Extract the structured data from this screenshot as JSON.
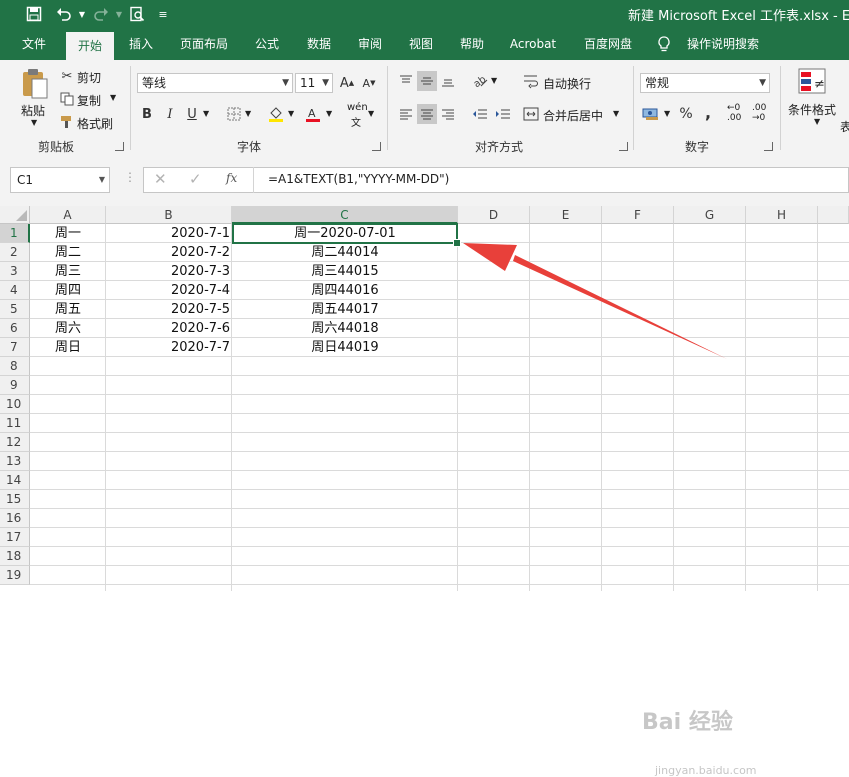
{
  "window": {
    "title": "新建 Microsoft Excel 工作表.xlsx - Exc"
  },
  "tabs": [
    "文件",
    "开始",
    "插入",
    "页面布局",
    "公式",
    "数据",
    "审阅",
    "视图",
    "帮助",
    "Acrobat",
    "百度网盘",
    "操作说明搜索"
  ],
  "ribbon": {
    "clipboard": {
      "paste": "粘贴",
      "cut": "剪切",
      "copy": "复制",
      "format_painter": "格式刷",
      "label": "剪贴板"
    },
    "font": {
      "name": "等线",
      "size": "11",
      "bold": "B",
      "italic": "I",
      "underline": "U",
      "phonetic": "wén",
      "label": "字体"
    },
    "alignment": {
      "wrap_text": "自动换行",
      "merge_center": "合并后居中",
      "label": "对齐方式"
    },
    "number": {
      "format": "常规",
      "percent": "%",
      "comma": ",",
      "label": "数字"
    },
    "styles": {
      "conditional": "条件格式",
      "cut_text": "表"
    }
  },
  "formula_bar": {
    "name_box": "C1",
    "fx": "fx",
    "formula": "=A1&TEXT(B1,\"YYYY-MM-DD\")"
  },
  "sheet": {
    "columns": [
      "A",
      "B",
      "C",
      "D",
      "E",
      "F",
      "G",
      "H"
    ],
    "rows": [
      "1",
      "2",
      "3",
      "4",
      "5",
      "6",
      "7",
      "8",
      "9",
      "10",
      "11",
      "12",
      "13",
      "14",
      "15",
      "16",
      "17",
      "18",
      "19"
    ],
    "data": [
      [
        "周一",
        "2020-7-1",
        "周一2020-07-01"
      ],
      [
        "周二",
        "2020-7-2",
        "周二44014"
      ],
      [
        "周三",
        "2020-7-3",
        "周三44015"
      ],
      [
        "周四",
        "2020-7-4",
        "周四44016"
      ],
      [
        "周五",
        "2020-7-5",
        "周五44017"
      ],
      [
        "周六",
        "2020-7-6",
        "周六44018"
      ],
      [
        "周日",
        "2020-7-7",
        "周日44019"
      ]
    ],
    "selected_cell": "C1"
  },
  "watermark": {
    "brand": "Bai 经验",
    "url": "jingyan.baidu.com"
  },
  "colors": {
    "accent": "#217346",
    "annotation_arrow": "#e8403a"
  }
}
